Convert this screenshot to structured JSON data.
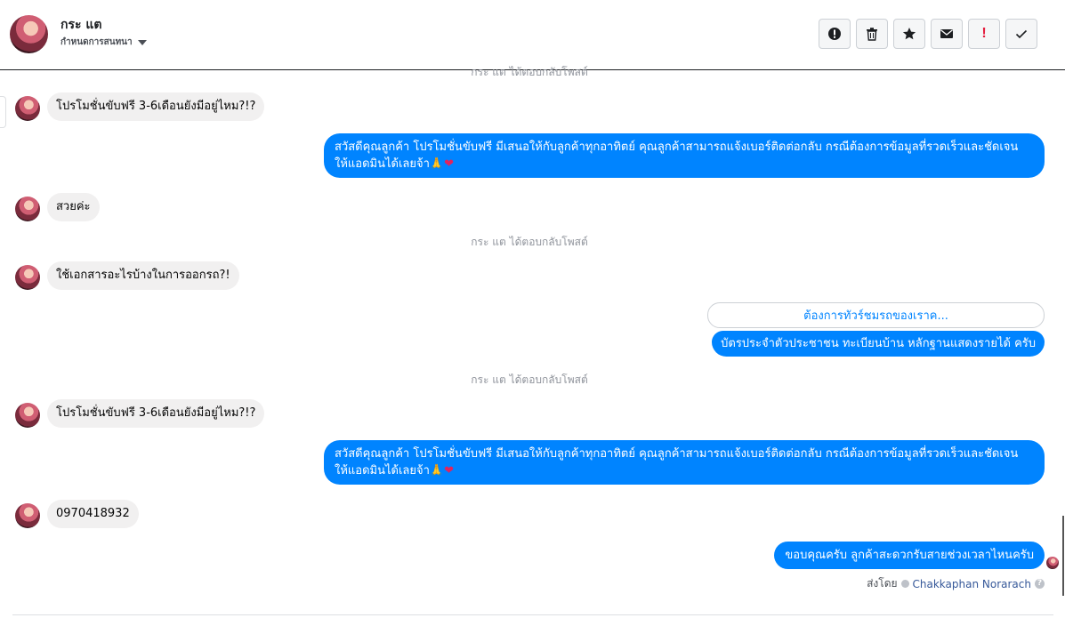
{
  "header": {
    "contact_name": "กระ แต",
    "subtitle": "กำหนดการสนทนา",
    "toolbar": [
      {
        "name": "info-button",
        "icon": "info-circle-icon"
      },
      {
        "name": "delete-button",
        "icon": "trash-icon"
      },
      {
        "name": "star-button",
        "icon": "star-icon"
      },
      {
        "name": "mark-unread-button",
        "icon": "envelope-icon"
      },
      {
        "name": "spam-button",
        "icon": "exclamation-icon",
        "label": "!"
      },
      {
        "name": "done-button",
        "icon": "check-icon"
      }
    ]
  },
  "thread": {
    "system_top": "กระ แต ได้ตอบกลับโพสต์",
    "msg1": "โปรโมชั่นขับฟรี 3-6เดือนยังมีอยู่ไหม?!?",
    "reply1_line1": "สวัสดีคุณลูกค้า โปรโมชั่นขับฟรี มีเสนอให้กับลูกค้าทุกอาทิตย์ คุณลูกค้าสามารถแจ้งเบอร์ติดต่อกลับ กรณีต้องการข้อมูลที่รวดเร็วและชัดเจน",
    "reply1_line2": "ให้แอดมินได้เลยจ้า🙏",
    "heart": "❤",
    "msg2": "สวยค่ะ",
    "system2": "กระ แต ได้ตอบกลับโพสต์",
    "msg3": "ใช้เอกสารอะไรบ้างในการออกรถ?!",
    "quick_reply": "ต้องการทัวร์ชมรถของเราค...",
    "reply2": "บัตรประจำตัวประชาชน ทะเบียนบ้าน หลักฐานแสดงรายได้ ครับ",
    "system3": "กระ แต ได้ตอบกลับโพสต์",
    "msg4": "โปรโมชั่นขับฟรี 3-6เดือนยังมีอยู่ไหม?!?",
    "reply3_line1": "สวัสดีคุณลูกค้า โปรโมชั่นขับฟรี มีเสนอให้กับลูกค้าทุกอาทิตย์ คุณลูกค้าสามารถแจ้งเบอร์ติดต่อกลับ กรณีต้องการข้อมูลที่รวดเร็วและชัดเจน",
    "reply3_line2": "ให้แอดมินได้เลยจ้า🙏",
    "msg5": "0970418932",
    "reply4": "ขอบคุณครับ ลูกค้าสะดวกรับสายช่วงเวลาไหนครับ",
    "sent_by_label": "ส่งโดย",
    "sent_by_name": "Chakkaphan Norarach",
    "help": "?"
  },
  "colors": {
    "outgoing": "#0084ff",
    "incoming": "#f1f0f0",
    "system_text": "#90949c"
  }
}
